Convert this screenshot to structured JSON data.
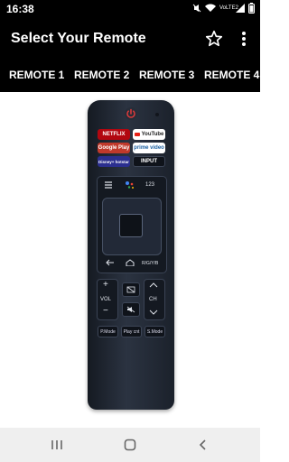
{
  "status_bar": {
    "time": "16:38",
    "network_label": "VoLTE2",
    "icons": [
      "mute-icon",
      "wifi-icon",
      "signal-icon",
      "battery-icon"
    ]
  },
  "app_bar": {
    "title": "Select Your Remote",
    "icons": [
      "star-icon",
      "more-vert-icon"
    ]
  },
  "tabs": [
    {
      "label": "REMOTE 1"
    },
    {
      "label": "REMOTE 2"
    },
    {
      "label": "REMOTE 3"
    },
    {
      "label": "REMOTE 4"
    }
  ],
  "remote": {
    "services": {
      "netflix": "NETFLIX",
      "youtube": "YouTube",
      "google_play": "Google Play",
      "prime_video": "prime video",
      "disney": "Disney+ hotstar",
      "input": "INPUT"
    },
    "row_labels": {
      "num": "123",
      "rgyb": "R/G/Y/B"
    },
    "volume_label": "VOL",
    "channel_label": "CH",
    "bottom": {
      "pmode": "P.Mode",
      "playcnt": "Play cnt",
      "smode": "S.Mode"
    },
    "colors": {
      "body": "#1f2530",
      "power": "#d22a2a",
      "netflix": "#b20710",
      "youtube_bg": "#ffffff",
      "google_play": "#c0392b",
      "prime": "#ffffff",
      "disney": "#2b2f8f"
    }
  },
  "nav_bar": {
    "icons": [
      "recents-icon",
      "home-icon",
      "back-icon"
    ]
  }
}
